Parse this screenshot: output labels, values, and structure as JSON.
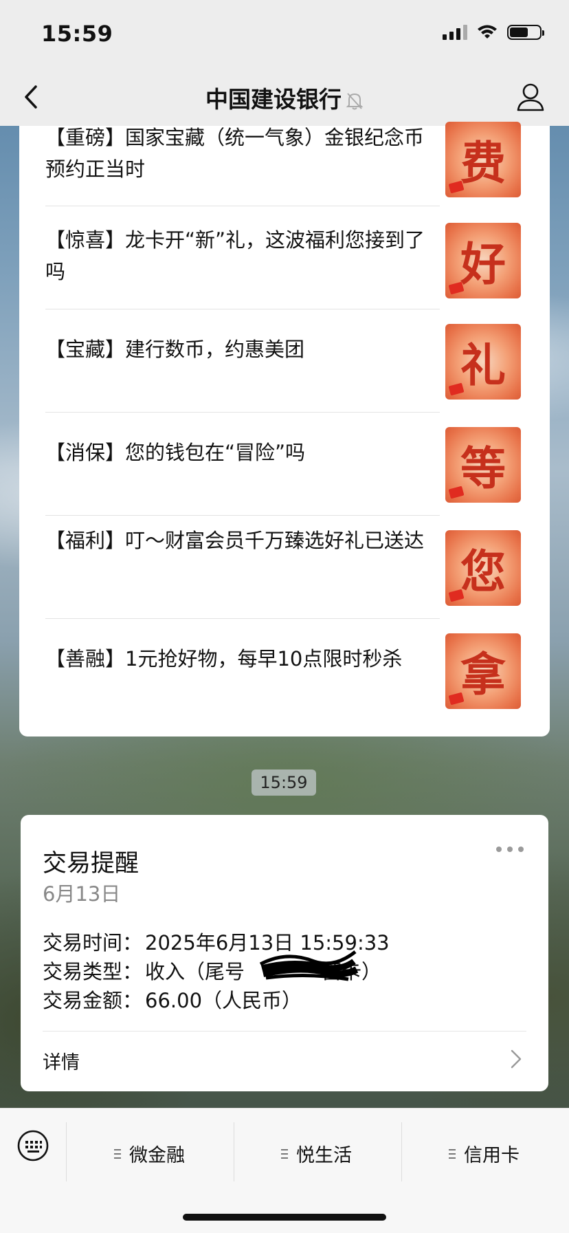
{
  "status_bar": {
    "time": "15:59"
  },
  "nav": {
    "title": "中国建设银行"
  },
  "articles": [
    {
      "text": "【重磅】国家宝藏（统一气象）金银纪念币预约正当时",
      "thumb_char": "费"
    },
    {
      "text": "【惊喜】龙卡开“新”礼，这波福利您接到了吗",
      "thumb_char": "好"
    },
    {
      "text": "【宝藏】建行数币，约惠美团",
      "thumb_char": "礼"
    },
    {
      "text": "【消保】您的钱包在“冒险”吗",
      "thumb_char": "等"
    },
    {
      "text": "【福利】叮～财富会员千万臻选好礼已送达",
      "thumb_char": "您"
    },
    {
      "text": "【善融】1元抢好物，每早10点限时秒杀",
      "thumb_char": "拿"
    }
  ],
  "chat_time": "15:59",
  "transaction": {
    "title": "交易提醒",
    "date": "6月13日",
    "time_label": "交易时间：",
    "time_value": "2025年6月13日 15:59:33",
    "type_label": "交易类型：",
    "type_value": "收入（尾号",
    "type_suffix": "蓄卡）",
    "amount_label": "交易金额：",
    "amount_value": "66.00（人民币）",
    "detail_label": "详情"
  },
  "menu": {
    "items": [
      {
        "label": "微金融"
      },
      {
        "label": "悦生活"
      },
      {
        "label": "信用卡"
      }
    ]
  },
  "colors": {
    "thumb_glyph": "#c6301c",
    "thumb_bg": "#e8734a"
  }
}
